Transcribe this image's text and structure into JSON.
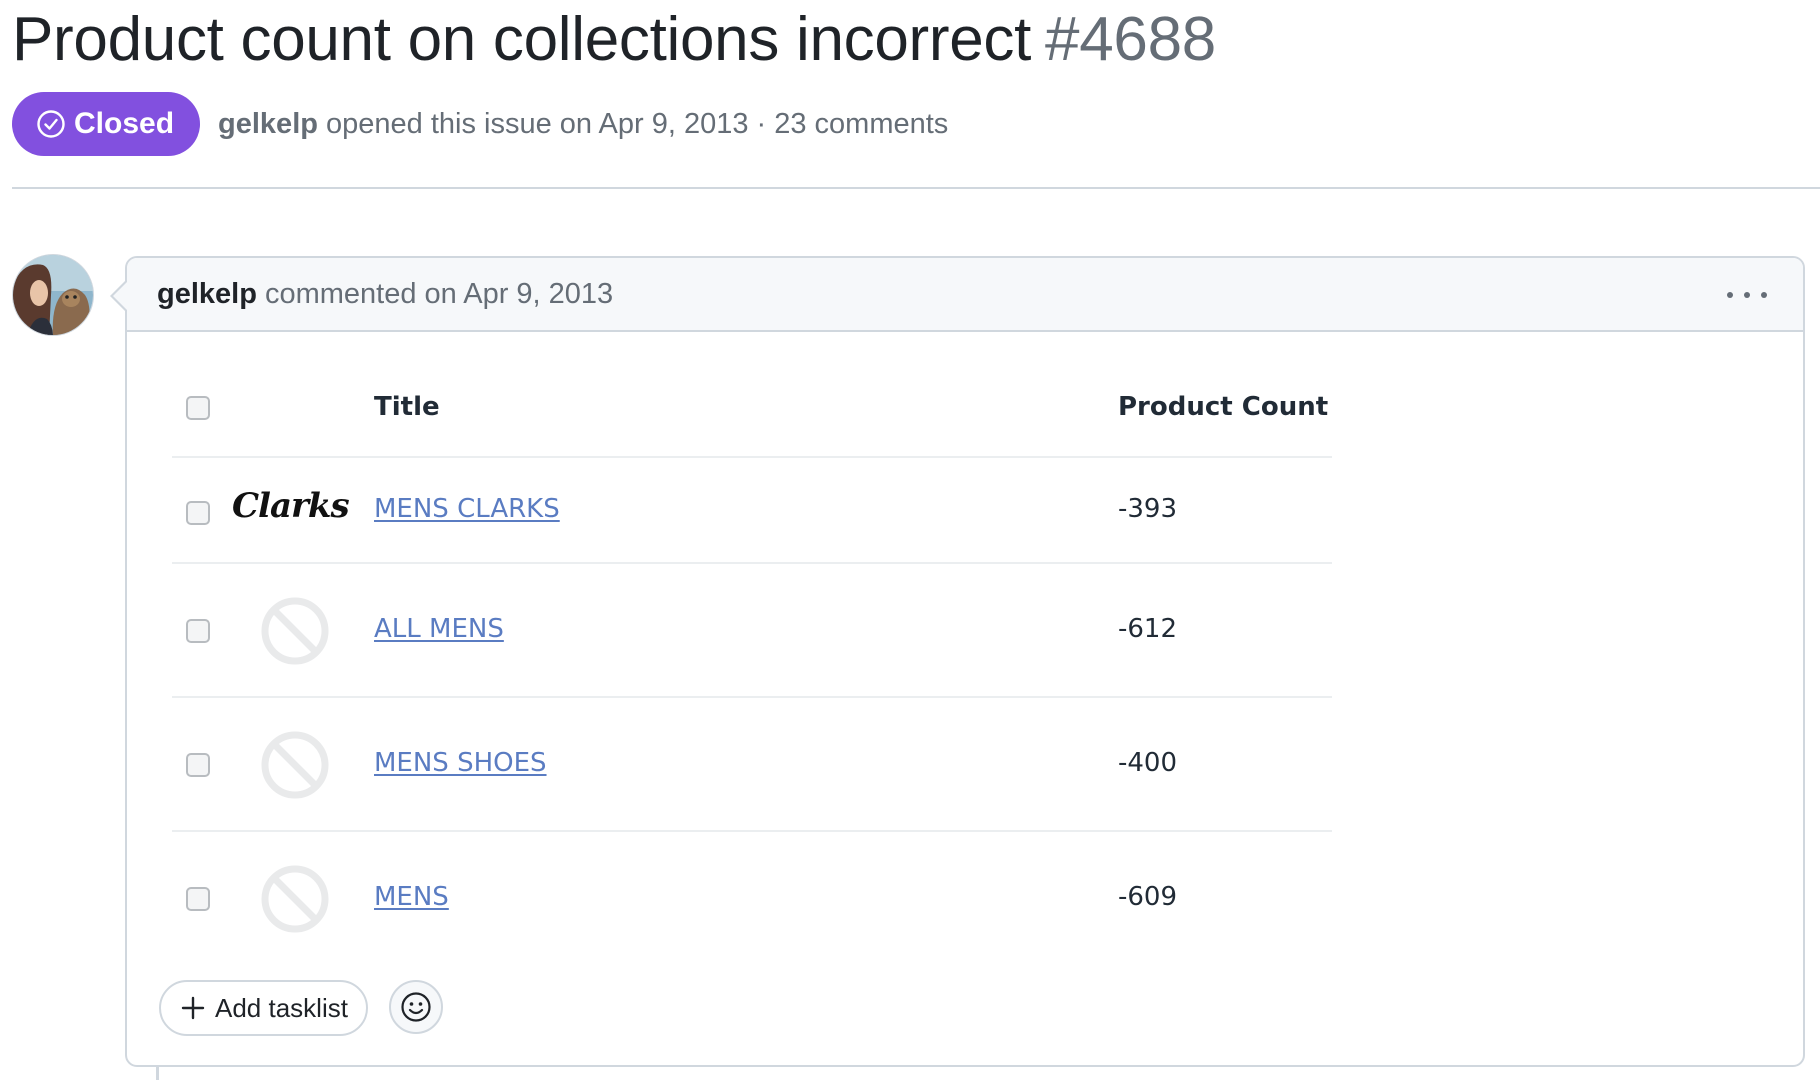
{
  "issue": {
    "title": "Product count on collections incorrect",
    "number": "#4688",
    "state": "Closed",
    "author": "gelkelp",
    "opened_text": "opened this issue on Apr 9, 2013 · 23 comments"
  },
  "comment": {
    "author": "gelkelp",
    "meta": "commented on Apr 9, 2013"
  },
  "table": {
    "headers": {
      "title": "Title",
      "count": "Product Count"
    },
    "rows": [
      {
        "title": "MENS CLARKS",
        "count": "-393",
        "thumb_text": "Clarks"
      },
      {
        "title": "ALL MENS",
        "count": "-612"
      },
      {
        "title": "MENS SHOES",
        "count": "-400"
      },
      {
        "title": "MENS",
        "count": "-609"
      }
    ]
  },
  "footer": {
    "add_tasklist": "Add tasklist"
  },
  "colors": {
    "closed_badge": "#8250df",
    "link": "#5a7cc2",
    "border": "#d0d7de",
    "muted": "#656d76"
  }
}
